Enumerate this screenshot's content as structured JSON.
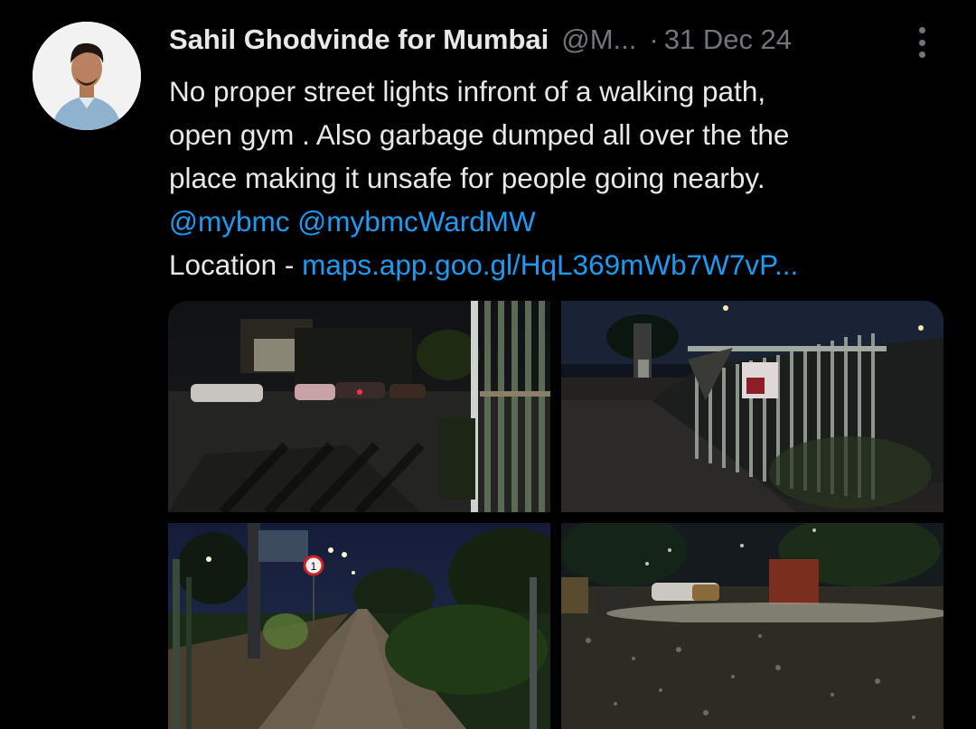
{
  "tweet": {
    "author_name": "Sahil Ghodvinde for Mumbai",
    "handle": "@M...",
    "separator": "·",
    "date": "31 Dec 24",
    "text_lines": [
      "No proper street lights infront of a walking path,",
      "open gym . Also garbage dumped all over the the",
      "place making it unsafe for people going nearby."
    ],
    "mentions": "@mybmc @mybmcWardMW",
    "location_label": "Location - ",
    "location_link": "maps.app.goo.gl/HqL369mWb7W7vP..."
  },
  "media": {
    "photos": [
      {
        "label": "night-street-parked-cars-gate"
      },
      {
        "label": "dark-footpath-broken-fence"
      },
      {
        "label": "walking-path-street-lights"
      },
      {
        "label": "garbage-road-night"
      }
    ],
    "sign_number": "1"
  },
  "colors": {
    "background": "#000000",
    "text": "#e7e9ea",
    "secondary": "#71767b",
    "link": "#1d9bf0"
  }
}
